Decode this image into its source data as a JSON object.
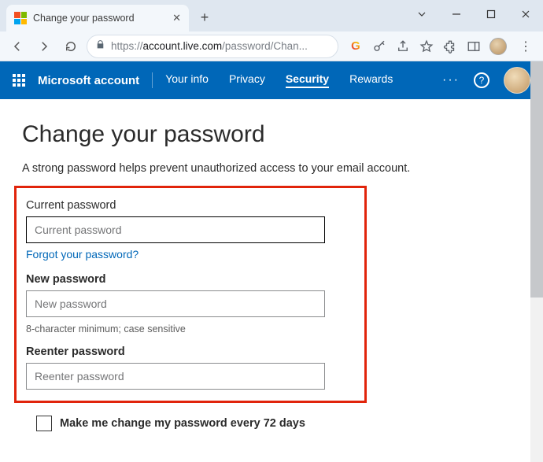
{
  "browser": {
    "tab_title": "Change your password",
    "url_https": "https://",
    "url_host": "account.live.com",
    "url_path": "/password/Chan...",
    "window_controls": {
      "minimize": "minimize",
      "chevron": "chevron",
      "maximize": "maximize",
      "close": "close"
    }
  },
  "header": {
    "brand": "Microsoft account",
    "links": [
      "Your info",
      "Privacy",
      "Security",
      "Rewards"
    ],
    "active_index": 2
  },
  "page": {
    "title": "Change your password",
    "subtext": "A strong password helps prevent unauthorized access to your email account.",
    "current_label": "Current password",
    "current_placeholder": "Current password",
    "forgot_link": "Forgot your password?",
    "new_label": "New password",
    "new_placeholder": "New password",
    "hint": "8-character minimum; case sensitive",
    "reenter_label": "Reenter password",
    "reenter_placeholder": "Reenter password",
    "checkbox_label": "Make me change my password every 72 days"
  }
}
